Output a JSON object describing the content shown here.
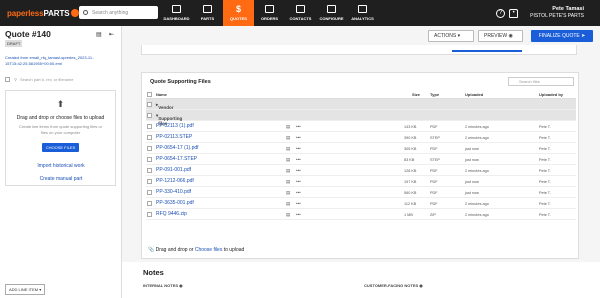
{
  "app": {
    "logo_part1": "paperless",
    "logo_part2": "PARTS",
    "search_placeholder": "Search anything"
  },
  "nav": [
    {
      "label": "DASHBOARD",
      "icon": "dashboard-icon"
    },
    {
      "label": "PARTS",
      "icon": "parts-icon"
    },
    {
      "label": "QUOTES",
      "icon": "quotes-icon",
      "active": true
    },
    {
      "label": "ORDERS",
      "icon": "orders-icon"
    },
    {
      "label": "CONTACTS",
      "icon": "contacts-icon"
    },
    {
      "label": "CONFIGURE",
      "icon": "configure-icon"
    },
    {
      "label": "ANALYTICS",
      "icon": "analytics-icon"
    }
  ],
  "user": {
    "name": "Pete Tamasi",
    "company": "PISTOL PETE'S PARTS"
  },
  "quote": {
    "title": "Quote #140",
    "status": "DRAFT",
    "created_from": "Created from email_rfq_tamasi-spredes_2023-11-15T15:42:25.581955+00:00.eml"
  },
  "left": {
    "select_placeholder": "Search part #, rev, or filename",
    "upload_title": "Drag and drop or choose files to upload",
    "upload_sub": "Create line items from quote supporting files or files on your computer",
    "choose_files": "CHOOSE FILES",
    "import_link": "Import historical work",
    "manual_link": "Create manual part",
    "add_line_item": "ADD LINE ITEM"
  },
  "toolbar": {
    "actions": "ACTIONS",
    "preview": "PREVIEW",
    "finalize": "FINALIZE QUOTE"
  },
  "files": {
    "title": "Quote Supporting Files",
    "search_placeholder": "Search files",
    "columns": {
      "name": "Name",
      "size": "Size",
      "type": "Type",
      "uploaded": "Uploaded",
      "uploaded_by": "Uploaded by"
    },
    "groups": [
      "Vendor quotes",
      "Supporting files"
    ],
    "rows": [
      {
        "name": "PP-02113 (1).pdf",
        "size": "143 KB",
        "type": "PDF",
        "uploaded": "2 minutes ago",
        "by": "Pete T."
      },
      {
        "name": "PP-02113.STEP",
        "size": "390 KB",
        "type": "STEP",
        "uploaded": "2 minutes ago",
        "by": "Pete T."
      },
      {
        "name": "PP-0654-17 (1).pdf",
        "size": "305 KB",
        "type": "PDF",
        "uploaded": "just now",
        "by": "Pete T."
      },
      {
        "name": "PP-0654-17.STEP",
        "size": "83 KB",
        "type": "STEP",
        "uploaded": "just now",
        "by": "Pete T."
      },
      {
        "name": "PP-091-001.pdf",
        "size": "128 KB",
        "type": "PDF",
        "uploaded": "2 minutes ago",
        "by": "Pete T."
      },
      {
        "name": "PP-1212-066.pdf",
        "size": "197 KB",
        "type": "PDF",
        "uploaded": "just now",
        "by": "Pete T."
      },
      {
        "name": "PP-330-410.pdf",
        "size": "560 KB",
        "type": "PDF",
        "uploaded": "just now",
        "by": "Pete T."
      },
      {
        "name": "PP-3635-001.pdf",
        "size": "112 KB",
        "type": "PDF",
        "uploaded": "2 minutes ago",
        "by": "Pete T."
      },
      {
        "name": "RFQ 9446.zip",
        "size": "1 MB",
        "type": "ZIP",
        "uploaded": "2 minutes ago",
        "by": "Pete T."
      }
    ],
    "drop_text": "Drag and drop or",
    "drop_link": "Choose files",
    "drop_suffix": "to upload"
  },
  "notes": {
    "title": "Notes",
    "internal": "INTERNAL NOTES",
    "customer": "CUSTOMER-FACING NOTES"
  },
  "colors": {
    "brand": "#ff6a13",
    "primary": "#1a5dd8",
    "topbar": "#1f1f1f"
  }
}
